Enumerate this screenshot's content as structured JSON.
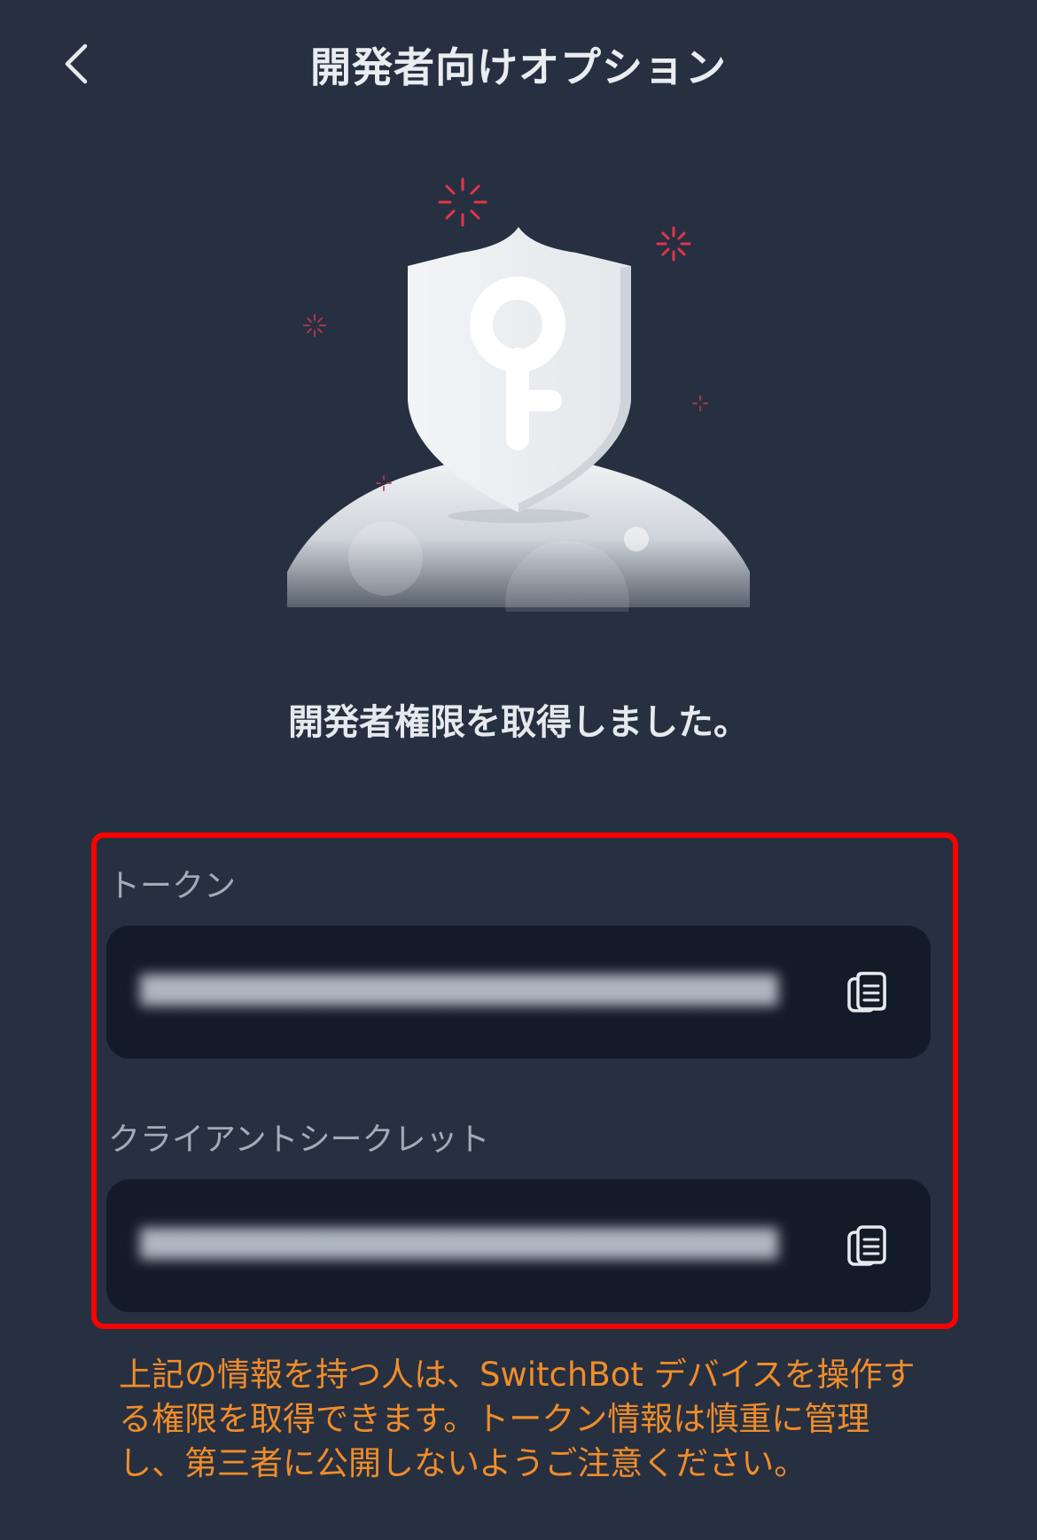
{
  "header": {
    "title": "開発者向けオプション",
    "back_icon": "chevron-left-icon"
  },
  "hero": {
    "illustration": "shield-key-icon"
  },
  "status_message": "開発者権限を取得しました。",
  "credentials": {
    "token": {
      "label": "トークン",
      "value": "████████████████████████████████████████",
      "copy_icon": "copy-icon"
    },
    "client_secret": {
      "label": "クライアントシークレット",
      "value": "████████████████████████████████████████",
      "copy_icon": "copy-icon"
    }
  },
  "notice": "上記の情報を持つ人は、SwitchBot デバイスを操作する権限を取得できます。トークン情報は慎重に管理し、第三者に公開しないようご注意ください。",
  "colors": {
    "background": "#263040",
    "field_background": "#141b28",
    "highlight_border": "#ff0000",
    "notice_text": "#f08c2a",
    "label_text": "#a4abb6"
  }
}
